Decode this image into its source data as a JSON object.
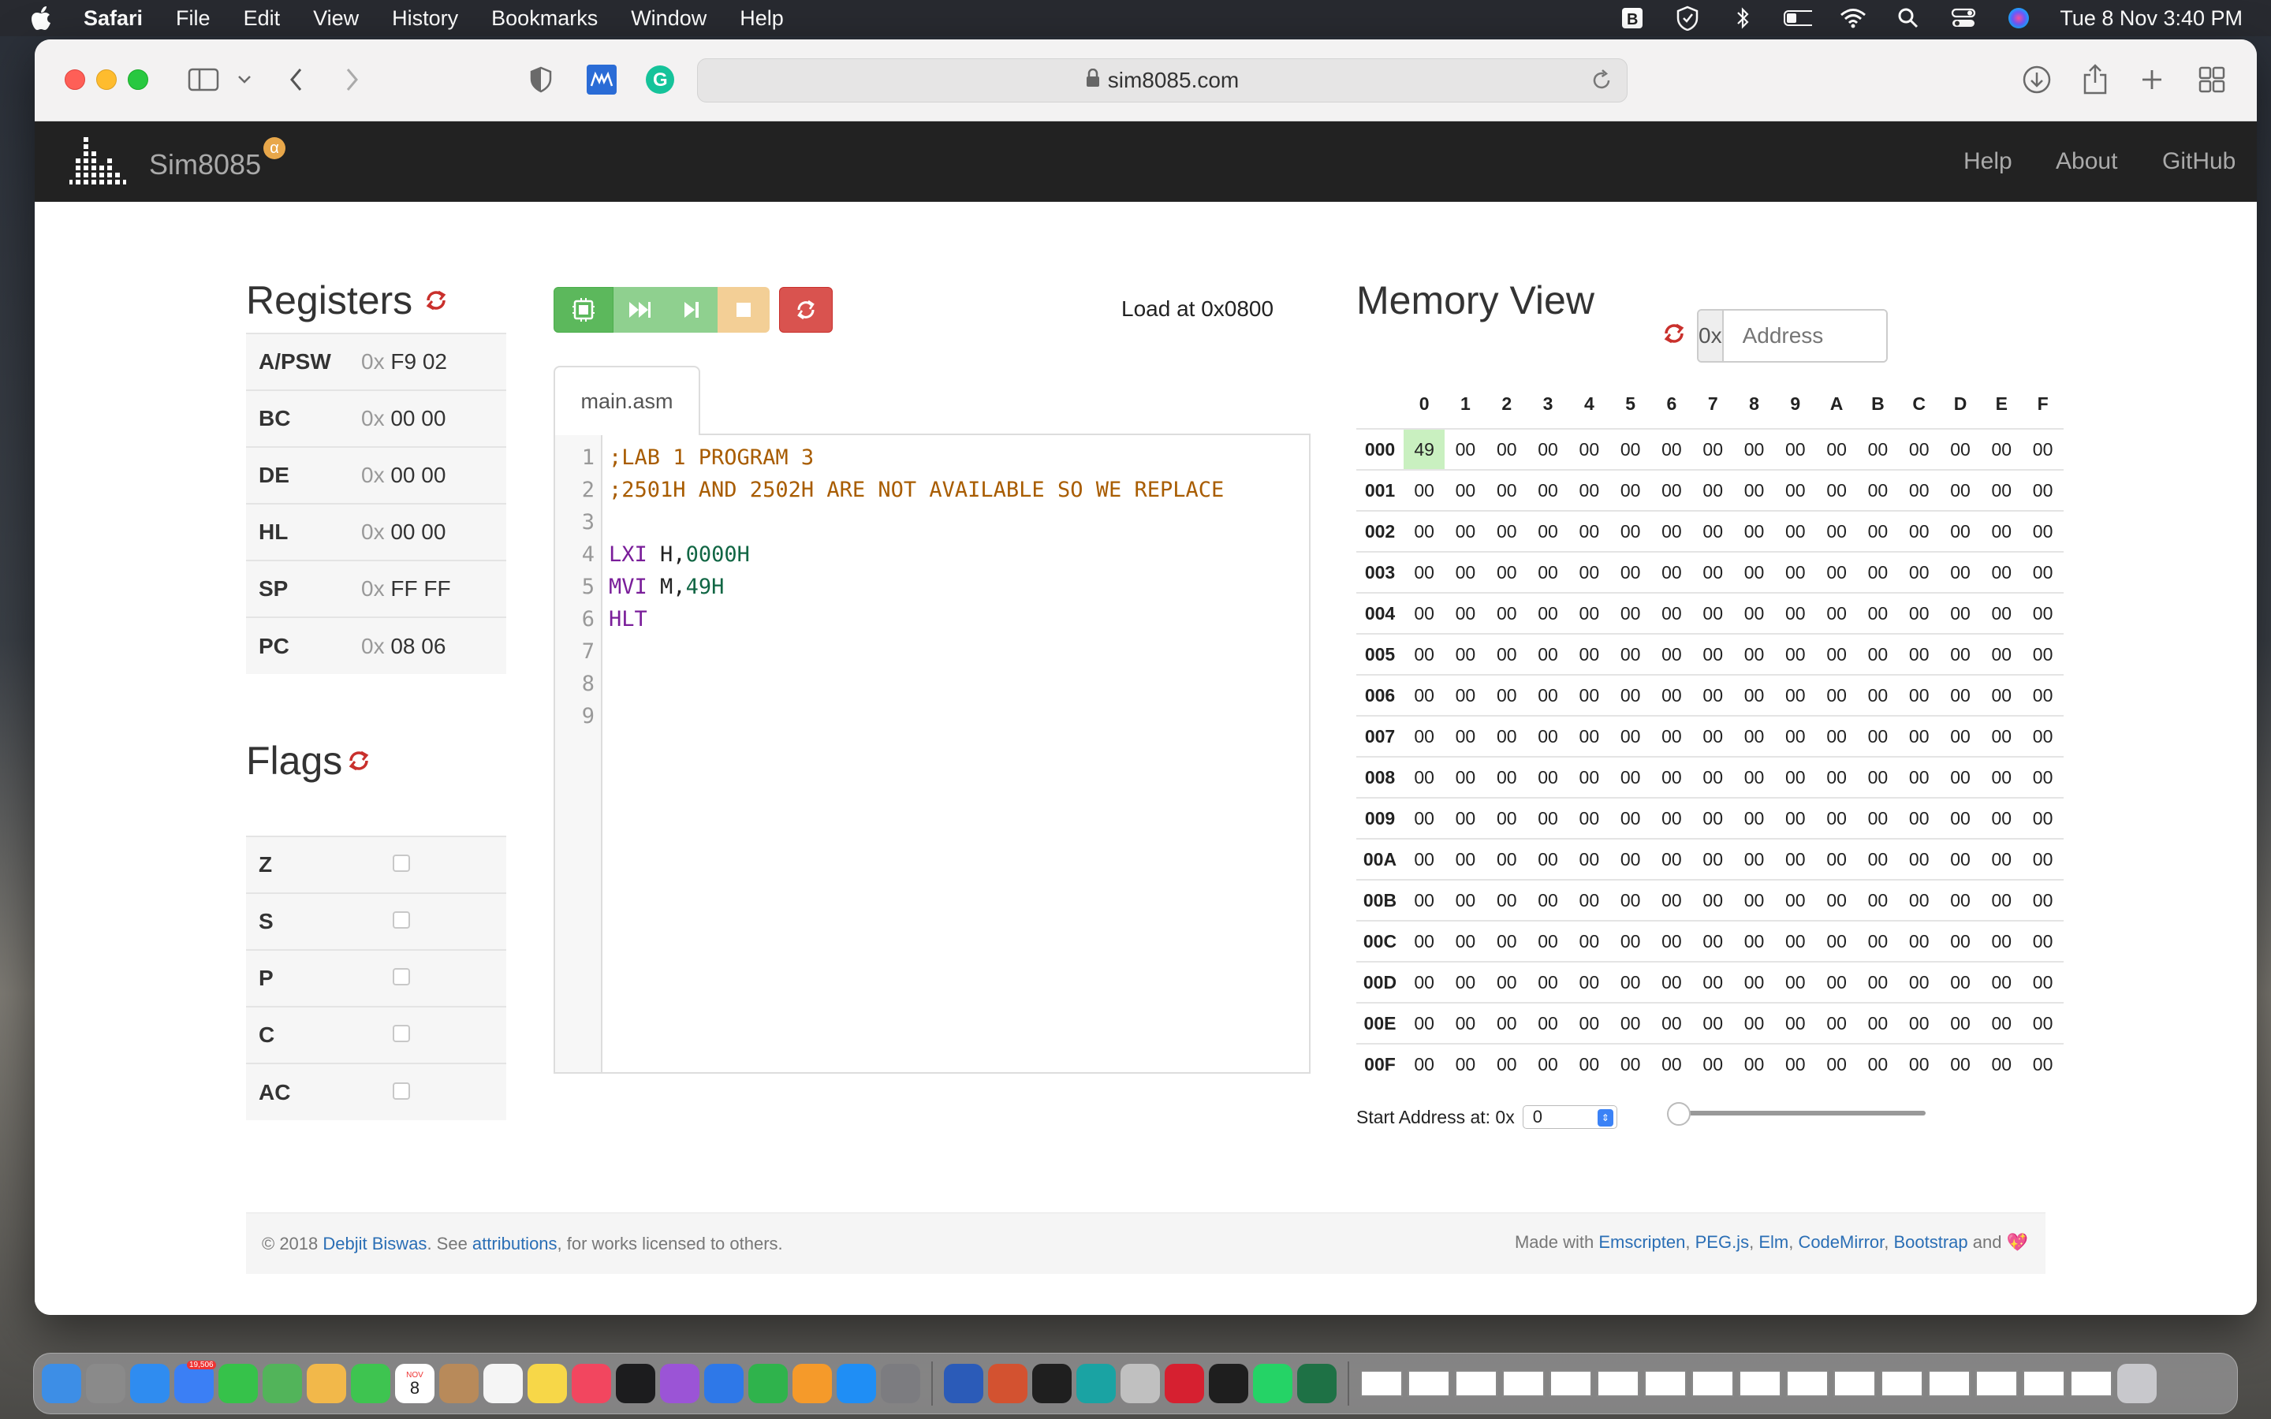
{
  "menubar": {
    "app": "Safari",
    "items": [
      "File",
      "Edit",
      "View",
      "History",
      "Bookmarks",
      "Window",
      "Help"
    ],
    "clock": "Tue 8 Nov  3:40 PM",
    "status_icons": [
      "bbedit-icon",
      "vpn-shield-icon",
      "bluetooth-icon",
      "battery-icon",
      "wifi-icon",
      "search-icon",
      "control-center-icon",
      "siri-icon"
    ]
  },
  "browser": {
    "url": "sim8085.com"
  },
  "navbar": {
    "brand": "Sim8085",
    "badge": "α",
    "links": [
      "Help",
      "About",
      "GitHub"
    ]
  },
  "registers": {
    "title": "Registers",
    "prefix": "0x",
    "rows": [
      {
        "name": "A/PSW",
        "value": "F9 02"
      },
      {
        "name": "BC",
        "value": "00 00"
      },
      {
        "name": "DE",
        "value": "00 00"
      },
      {
        "name": "HL",
        "value": "00 00"
      },
      {
        "name": "SP",
        "value": "FF FF"
      },
      {
        "name": "PC",
        "value": "08 06"
      }
    ]
  },
  "flags": {
    "title": "Flags",
    "rows": [
      {
        "name": "Z",
        "checked": false
      },
      {
        "name": "S",
        "checked": false
      },
      {
        "name": "P",
        "checked": false
      },
      {
        "name": "C",
        "checked": false
      },
      {
        "name": "AC",
        "checked": false
      }
    ]
  },
  "editor": {
    "load_at": "Load at 0x0800",
    "tab": "main.asm",
    "lines": [
      {
        "n": "1",
        "tokens": [
          {
            "t": ";LAB 1 PROGRAM 3",
            "c": "cm-comment"
          }
        ]
      },
      {
        "n": "2",
        "tokens": [
          {
            "t": ";2501H AND 2502H ARE NOT AVAILABLE SO WE REPLACE",
            "c": "cm-comment"
          }
        ]
      },
      {
        "n": "3",
        "tokens": []
      },
      {
        "n": "4",
        "tokens": [
          {
            "t": "LXI",
            "c": "cm-kw"
          },
          {
            "t": " H,",
            "c": "cm-plain"
          },
          {
            "t": "0000H",
            "c": "cm-num"
          }
        ]
      },
      {
        "n": "5",
        "tokens": [
          {
            "t": "MVI",
            "c": "cm-kw"
          },
          {
            "t": " M,",
            "c": "cm-plain"
          },
          {
            "t": "49H",
            "c": "cm-num"
          }
        ]
      },
      {
        "n": "6",
        "tokens": [
          {
            "t": "HLT",
            "c": "cm-kw"
          }
        ]
      },
      {
        "n": "7",
        "tokens": []
      },
      {
        "n": "8",
        "tokens": []
      },
      {
        "n": "9",
        "tokens": []
      }
    ]
  },
  "memory": {
    "title": "Memory View",
    "addr_prefix": "0x",
    "addr_placeholder": "Address",
    "columns": [
      "0",
      "1",
      "2",
      "3",
      "4",
      "5",
      "6",
      "7",
      "8",
      "9",
      "A",
      "B",
      "C",
      "D",
      "E",
      "F"
    ],
    "rows": [
      "000",
      "001",
      "002",
      "003",
      "004",
      "005",
      "006",
      "007",
      "008",
      "009",
      "00A",
      "00B",
      "00C",
      "00D",
      "00E",
      "00F"
    ],
    "default_value": "00",
    "nonzero": [
      {
        "row": 0,
        "col": 0,
        "value": "49",
        "highlight": true
      }
    ],
    "start_label": "Start Address at: 0x",
    "start_value": "0",
    "slider_fraction": 0
  },
  "footer": {
    "copyright": "© 2018 ",
    "author": "Debjit Biswas",
    "see": ". See ",
    "attributions": "attributions",
    "licensed": ", for works licensed to others.",
    "made_with": "Made with ",
    "tools": [
      "Emscripten",
      "PEG.js",
      "Elm",
      "CodeMirror",
      "Bootstrap"
    ],
    "and": " and ",
    "heart": "💖"
  },
  "dock": {
    "apps": [
      "finder",
      "launchpad",
      "safari",
      "mail",
      "messages",
      "maps",
      "photos",
      "facetime",
      "calendar",
      "contacts",
      "reminders",
      "notes",
      "music",
      "tv",
      "podcasts",
      "keynote",
      "numbers",
      "pages",
      "app-store",
      "system-preferences",
      "word",
      "powerpoint",
      "terminal",
      "scrivener",
      "network-radar",
      "mendeley",
      "figma",
      "whatsapp",
      "excel"
    ],
    "mail_badge": "19,506",
    "calendar_day": "8",
    "calendar_month": "NOV"
  },
  "colors": {
    "assemble": "#5cb85c",
    "reset": "#d9534f",
    "stop": "#f3cf96",
    "highlight": "#c9f0c0",
    "navbar": "#222222"
  }
}
